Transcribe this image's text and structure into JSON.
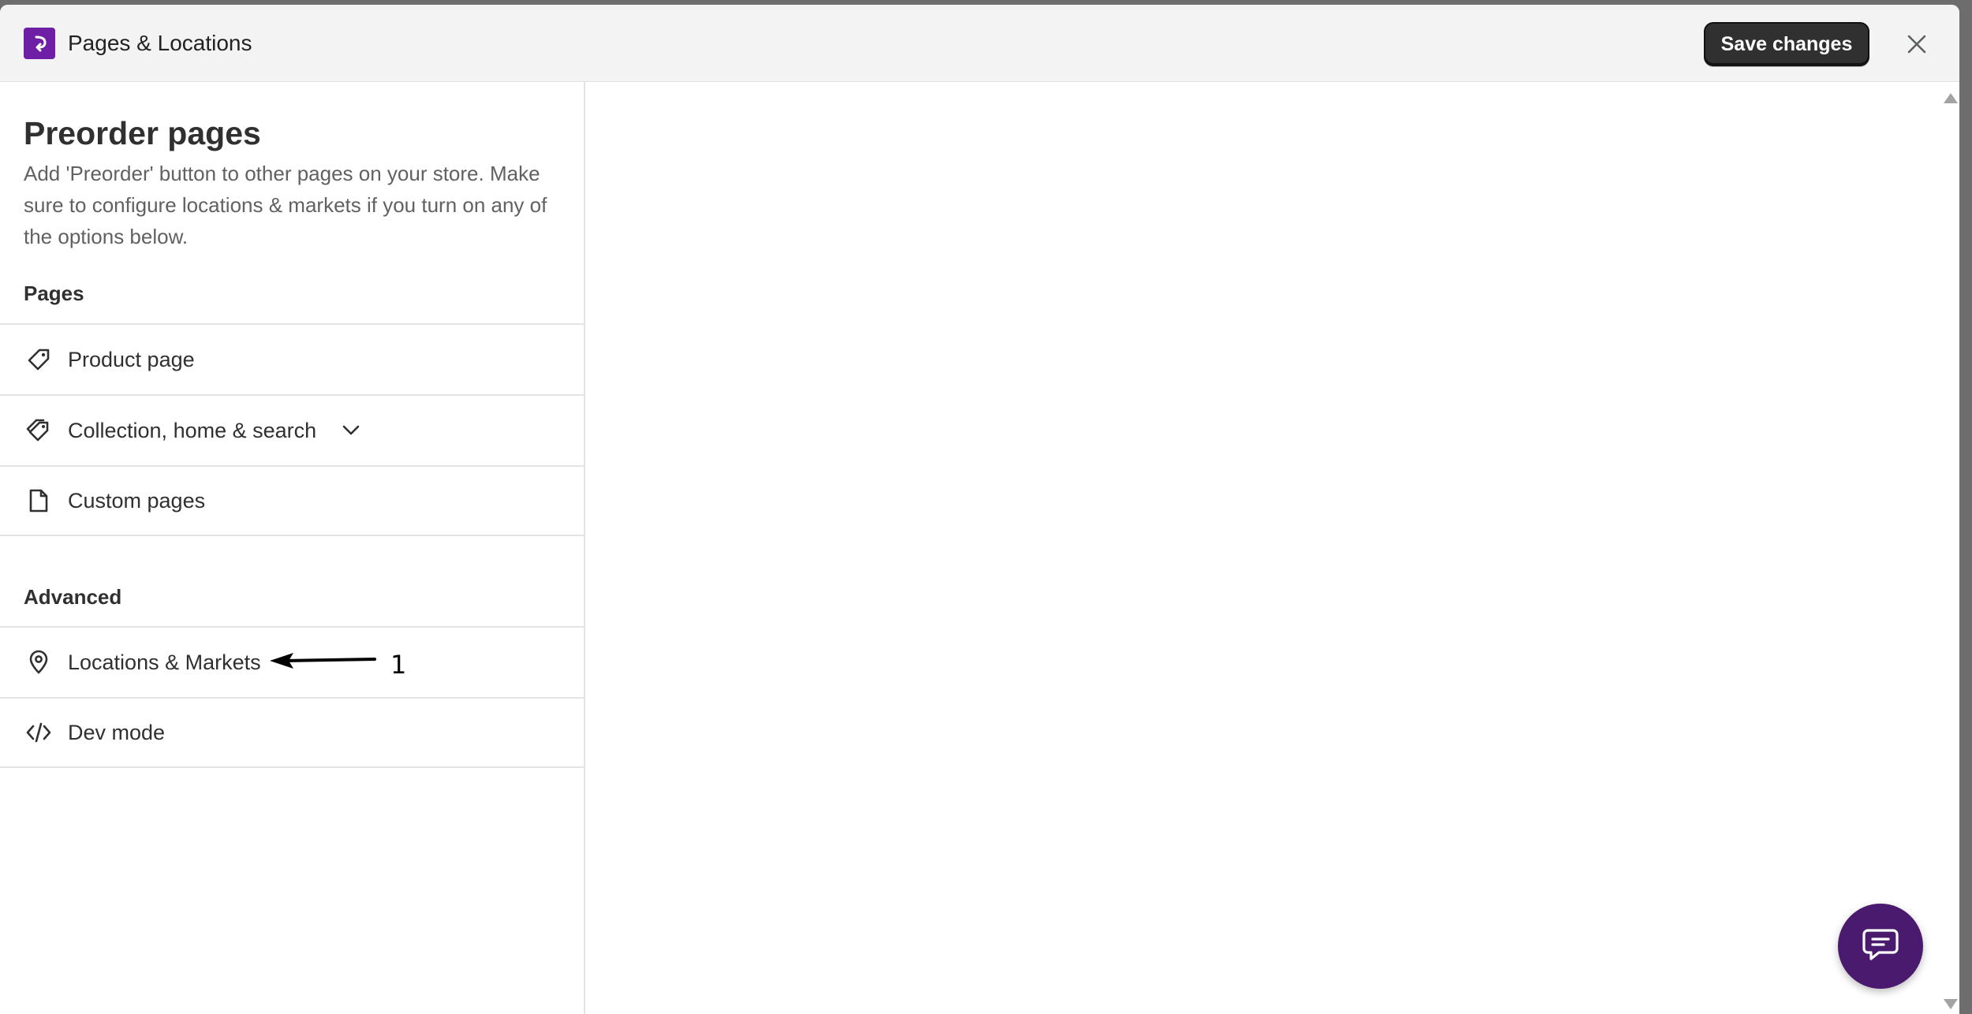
{
  "window": {
    "title": "Pages & Locations",
    "save_label": "Save changes"
  },
  "sidebar": {
    "heading": "Preorder pages",
    "description": "Add 'Preorder' button to other pages on your store. Make sure to configure locations & markets if you turn on any of the options below.",
    "pages_section": "Pages",
    "pages": [
      {
        "label": "Product page",
        "icon": "tag-icon"
      },
      {
        "label": "Collection, home & search",
        "icon": "tags-icon",
        "expandable": true
      },
      {
        "label": "Custom pages",
        "icon": "page-icon"
      }
    ],
    "advanced_section": "Advanced",
    "advanced": [
      {
        "label": "Locations & Markets",
        "icon": "location-pin-icon"
      },
      {
        "label": "Dev mode",
        "icon": "code-icon"
      }
    ]
  },
  "annotation": {
    "number": "1"
  },
  "colors": {
    "brand": "#6f1fa6",
    "chat_button": "#4a1a6e",
    "primary_button": "#303030"
  }
}
